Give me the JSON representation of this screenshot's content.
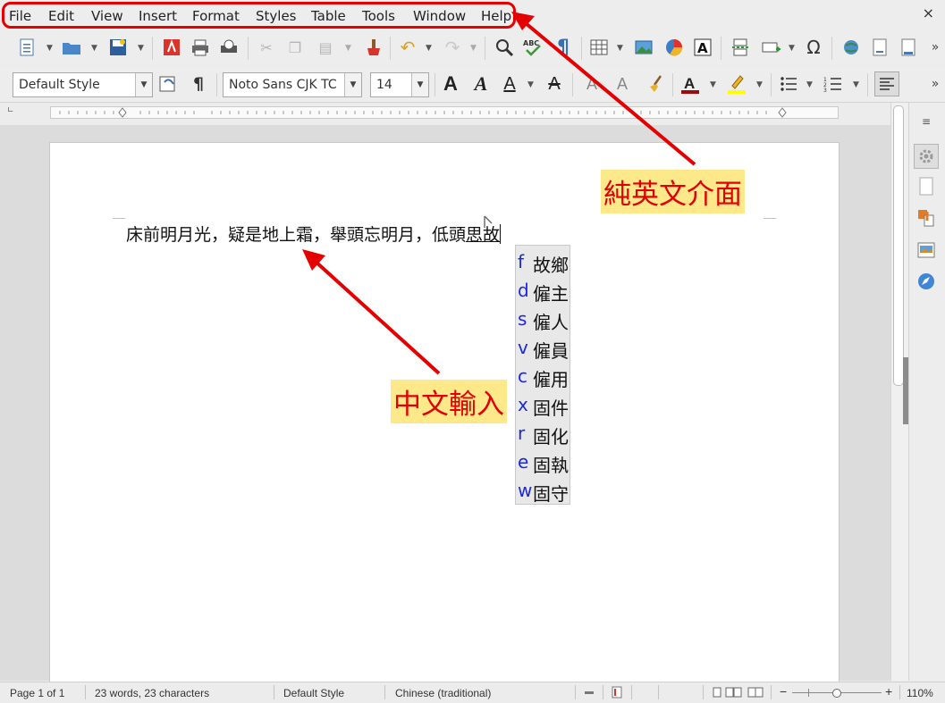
{
  "menubar": {
    "items": [
      "File",
      "Edit",
      "View",
      "Insert",
      "Format",
      "Styles",
      "Table",
      "Tools",
      "Window",
      "Help"
    ],
    "close_label": "×"
  },
  "toolbar2": {
    "paragraph_style": "Default Style",
    "font_name": "Noto Sans CJK TC",
    "font_size": "14"
  },
  "document": {
    "committed_text": "床前明月光，疑是地上霜，舉頭忘明月，低頭",
    "preedit_text": "思故"
  },
  "ime_candidates": [
    {
      "key": "f",
      "word": "故鄉"
    },
    {
      "key": "d",
      "word": "僱主"
    },
    {
      "key": "s",
      "word": "僱人"
    },
    {
      "key": "v",
      "word": "僱員"
    },
    {
      "key": "c",
      "word": "僱用"
    },
    {
      "key": "x",
      "word": "固件"
    },
    {
      "key": "r",
      "word": "固化"
    },
    {
      "key": "e",
      "word": "固執"
    },
    {
      "key": "w",
      "word": "固守"
    }
  ],
  "annotations": {
    "english_ui": "純英文介面",
    "chinese_input": "中文輸入",
    "highlight_color": "#e40000",
    "label_bg": "#fde98a"
  },
  "status_bar": {
    "page": "Page 1 of 1",
    "words": "23 words, 23 characters",
    "style": "Default Style",
    "language": "Chinese (traditional)",
    "zoom": "110%"
  }
}
